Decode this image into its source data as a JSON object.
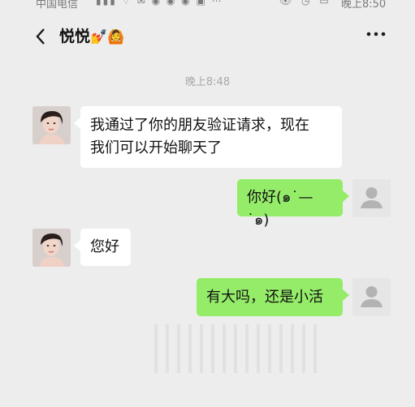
{
  "status_bar": {
    "carrier": "中国电信",
    "time": "晚上8:50"
  },
  "nav": {
    "title": "悦悦",
    "title_emoji": "💅🙆"
  },
  "chat": {
    "timestamp": "晚上8:48",
    "messages": [
      {
        "sender": "contact",
        "text_line1": "我通过了你的朋友验证请求，现在",
        "text_line2": "我们可以开始聊天了"
      },
      {
        "sender": "self",
        "text": "你好(๑˙—˙๑)"
      },
      {
        "sender": "contact",
        "text": "您好"
      },
      {
        "sender": "self",
        "text": "有大吗，还是小活"
      }
    ]
  },
  "colors": {
    "background": "#ededed",
    "outgoing_bubble": "#95ec69",
    "incoming_bubble": "#ffffff"
  },
  "icons": [
    "back-icon",
    "more-icon",
    "contact-avatar",
    "self-avatar"
  ]
}
